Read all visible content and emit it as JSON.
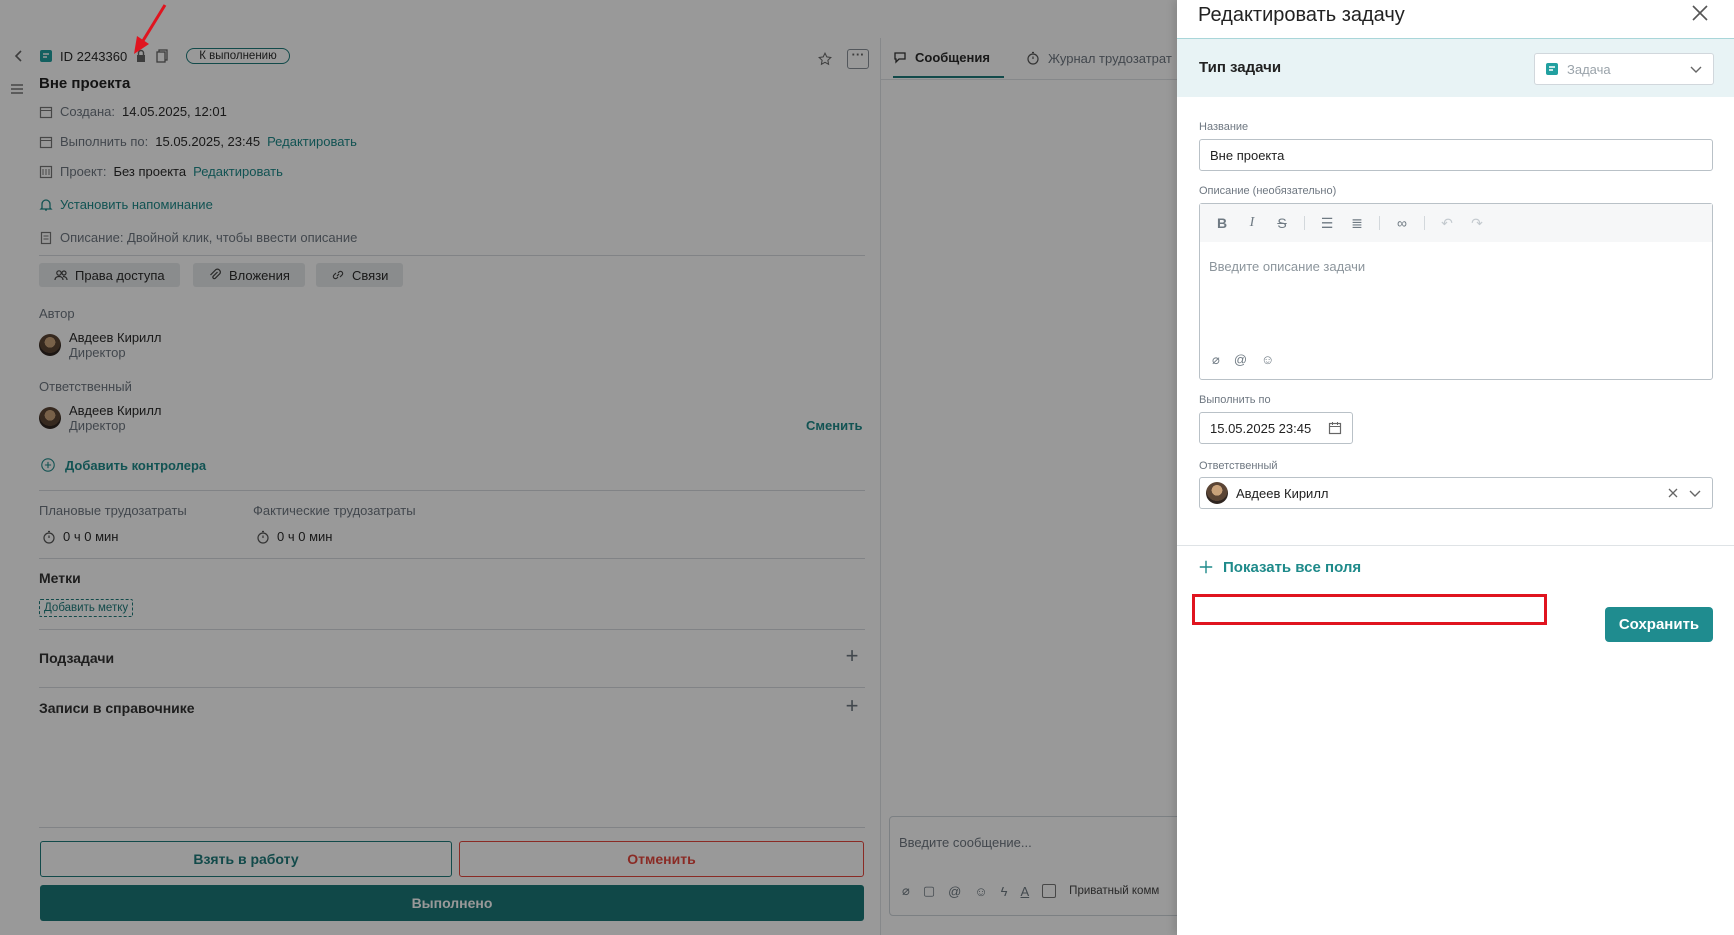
{
  "task": {
    "id": "ID 2243360",
    "status": "К выполнению",
    "title": "Вне проекта",
    "created_label": "Создана:",
    "created_value": "14.05.2025, 12:01",
    "due_label": "Выполнить по:",
    "due_value": "15.05.2025, 23:45",
    "edit_link": "Редактировать",
    "project_label": "Проект:",
    "project_value": "Без проекта",
    "reminder": "Установить напоминание",
    "description": "Описание: Двойной клик, чтобы ввести описание",
    "chips": [
      "Права доступа",
      "Вложения",
      "Связи"
    ],
    "author_heading": "Автор",
    "author_name": "Авдеев Кирилл",
    "author_role": "Директор",
    "assignee_heading": "Ответственный",
    "assignee_name": "Авдеев Кирилл",
    "assignee_role": "Директор",
    "change_link": "Сменить",
    "add_controller": "Добавить контролера",
    "planned_label": "Плановые трудозатраты",
    "planned_value": "0 ч 0 мин",
    "actual_label": "Фактические трудозатраты",
    "actual_value": "0 ч 0 мин",
    "tags_heading": "Метки",
    "add_tag": "Добавить метку",
    "subtasks": "Подзадачи",
    "records": "Записи в справочнике",
    "btn_take": "Взять в работу",
    "btn_cancel": "Отменить",
    "btn_done": "Выполнено"
  },
  "chat": {
    "tab_messages": "Сообщения",
    "tab_log": "Журнал трудозатрат",
    "input_placeholder": "Введите сообщение...",
    "private_label": "Приватный комментарий"
  },
  "drawer": {
    "title": "Редактировать задачу",
    "type_label": "Тип задачи",
    "type_value": "Задача",
    "name_label": "Название",
    "name_value": "Вне проекта",
    "desc_label": "Описание (необязательно)",
    "desc_placeholder": "Введите описание задачи",
    "due_label": "Выполнить по",
    "due_value": "15.05.2025 23:45",
    "assignee_label": "Ответственный",
    "assignee_value": "Авдеев Кирилл",
    "show_all": "Показать все поля",
    "save": "Сохранить"
  },
  "colors": {
    "accent": "#1e8a8a",
    "danger": "#e7483f",
    "annotation": "#e0141f"
  }
}
